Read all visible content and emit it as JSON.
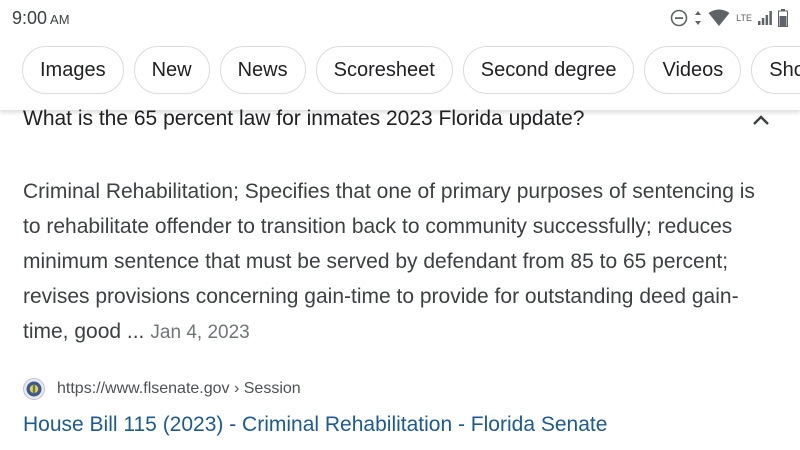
{
  "status_bar": {
    "time": "9:00",
    "ampm": "AM",
    "icons": [
      "do-not-disturb-icon",
      "data-arrows-icon",
      "wifi-icon",
      "lte-icon",
      "signal-icon",
      "battery-icon"
    ],
    "lte_label": "LTE"
  },
  "chips": [
    {
      "label": "Images"
    },
    {
      "label": "New"
    },
    {
      "label": "News"
    },
    {
      "label": "Scoresheet"
    },
    {
      "label": "Second degree"
    },
    {
      "label": "Videos"
    },
    {
      "label": "Sho"
    }
  ],
  "question": {
    "text": "What is the 65 percent law for inmates 2023 Florida update?",
    "expanded": true
  },
  "answer": {
    "snippet": "Criminal Rehabilitation; Specifies that one of primary purposes of sentencing is to rehabilitate offender to transition back to community successfully; reduces minimum sentence that must be served by defendant from 85 to 65 percent; revises provisions concerning gain-time to provide for outstanding deed gain-time, good ...",
    "date": "Jan 4, 2023"
  },
  "source": {
    "url": "https://www.flsenate.gov › Session",
    "title": "House Bill 115 (2023) - Criminal Rehabilitation - Florida Senate"
  },
  "colors": {
    "link": "#1a5a96",
    "text": "#3c4043",
    "chip_border": "#dadce0"
  }
}
